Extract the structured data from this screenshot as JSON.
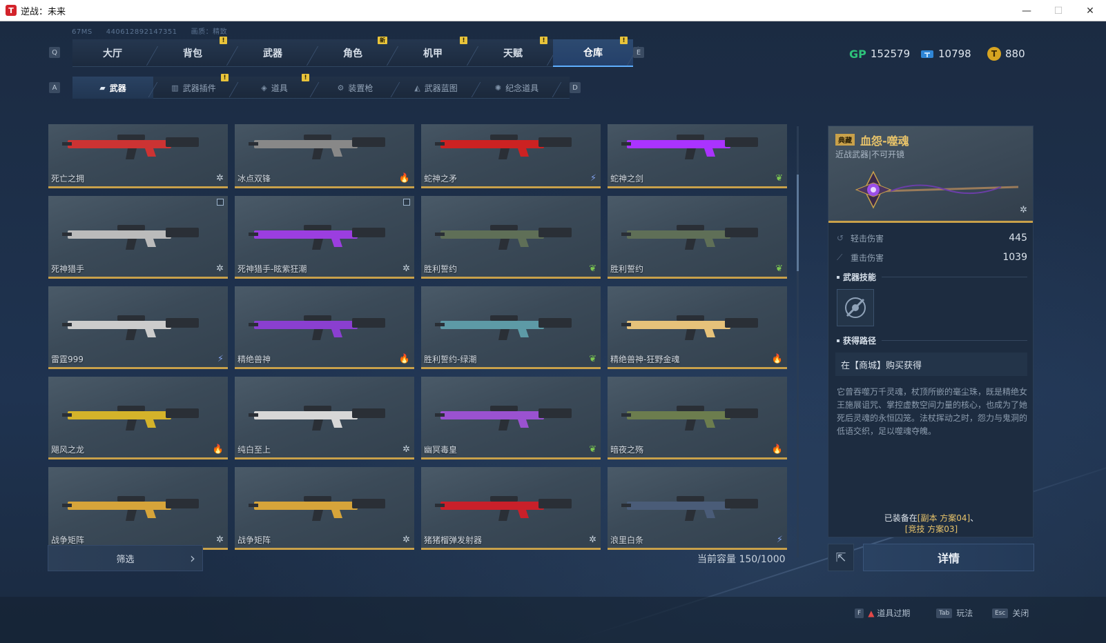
{
  "window": {
    "title": "逆战：未来",
    "app_icon_text": "T"
  },
  "account": {
    "ms": "67MS",
    "id": "440612892147351",
    "quality": "画质：精致"
  },
  "main_nav": {
    "key_prev": "Q",
    "key_next": "E",
    "tabs": [
      {
        "label": "大厅",
        "badge": ""
      },
      {
        "label": "背包",
        "badge": "!"
      },
      {
        "label": "武器",
        "badge": ""
      },
      {
        "label": "角色",
        "badge": "新"
      },
      {
        "label": "机甲",
        "badge": "!"
      },
      {
        "label": "天赋",
        "badge": "!"
      },
      {
        "label": "仓库",
        "badge": "!",
        "active": true
      }
    ]
  },
  "currency": {
    "gp_icon": "GP",
    "gp": "152579",
    "ticket": "10798",
    "coin_icon": "T",
    "coin": "880"
  },
  "sub_nav": {
    "key_prev": "A",
    "key_next": "D",
    "tabs": [
      {
        "label": "武器",
        "icon": "rifle-icon",
        "badge": "",
        "active": true
      },
      {
        "label": "武器插件",
        "icon": "plugin-icon",
        "badge": "!"
      },
      {
        "label": "道具",
        "icon": "item-icon",
        "badge": "!"
      },
      {
        "label": "装置枪",
        "icon": "device-gun-icon",
        "badge": ""
      },
      {
        "label": "武器蓝图",
        "icon": "blueprint-icon",
        "badge": ""
      },
      {
        "label": "纪念道具",
        "icon": "souvenir-icon",
        "badge": ""
      }
    ]
  },
  "weapons": [
    {
      "name": "死亡之拥",
      "element": "ice",
      "color": "#c33"
    },
    {
      "name": "冰点双锋",
      "element": "fire",
      "color": "#888"
    },
    {
      "name": "蛇神之矛",
      "element": "lightning",
      "color": "#c22"
    },
    {
      "name": "蛇神之剑",
      "element": "poison",
      "color": "#a3f"
    },
    {
      "name": "死神猎手",
      "element": "ice",
      "color": "#bbb",
      "checkbox": true
    },
    {
      "name": "死神猎手-眩紫狂潮",
      "element": "ice",
      "color": "#9b3ee0",
      "checkbox": true
    },
    {
      "name": "胜利誓约",
      "element": "poison",
      "color": "#5f6f57"
    },
    {
      "name": "胜利誓约",
      "element": "poison",
      "color": "#5f6f57"
    },
    {
      "name": "雷霆999",
      "element": "lightning",
      "color": "#ccc"
    },
    {
      "name": "精绝兽神",
      "element": "fire",
      "color": "#8a3fd0"
    },
    {
      "name": "胜利誓约-绿潮",
      "element": "poison",
      "color": "#5d9aa6"
    },
    {
      "name": "精绝兽神-狂野金魂",
      "element": "fire",
      "color": "#e6c27a"
    },
    {
      "name": "飓风之龙",
      "element": "fire",
      "color": "#d4b32a"
    },
    {
      "name": "纯白至上",
      "element": "ice",
      "color": "#d7d7d7"
    },
    {
      "name": "幽冥毒皇",
      "element": "poison",
      "color": "#9a52d0"
    },
    {
      "name": "暗夜之殇",
      "element": "fire",
      "color": "#6c7d4e"
    },
    {
      "name": "战争矩阵",
      "element": "ice",
      "color": "#d6a43a"
    },
    {
      "name": "战争矩阵",
      "element": "ice",
      "color": "#d6a43a"
    },
    {
      "name": "猪猪榴弹发射器",
      "element": "ice",
      "color": "#c9202a"
    },
    {
      "name": "浪里白条",
      "element": "lightning",
      "color": "#4a5c78"
    }
  ],
  "filter": {
    "label": "筛选"
  },
  "capacity": "当前容量 150/1000",
  "detail": {
    "tag": "典藏",
    "name": "血怨-噬魂",
    "subtitle": "近战武器|不可开镜",
    "stats": [
      {
        "label": "轻击伤害",
        "value": "445"
      },
      {
        "label": "重击伤害",
        "value": "1039"
      }
    ],
    "skill_title": "武器技能",
    "route_title": "获得路径",
    "route": "在【商城】购买获得",
    "description": "它曾吞噬万千灵魂，杖顶所嵌的毫尘珠，既是精绝女王施展诅咒、掌控虚数空间力量的核心，也成为了她死后灵魂的永恒囚笼。法杖挥动之时，怨力与鬼洞的低语交织，足以噬魂夺魄。",
    "equipped_prefix": "已装备在",
    "equipped_a": "[副本 方案04]",
    "equipped_sep": "、",
    "equipped_b": "[竞技 方案03]",
    "detail_button": "详情"
  },
  "footer": [
    {
      "key": "F",
      "label": "道具过期",
      "warn": true
    },
    {
      "key": "Tab",
      "label": "玩法"
    },
    {
      "key": "Esc",
      "label": "关闭"
    }
  ]
}
